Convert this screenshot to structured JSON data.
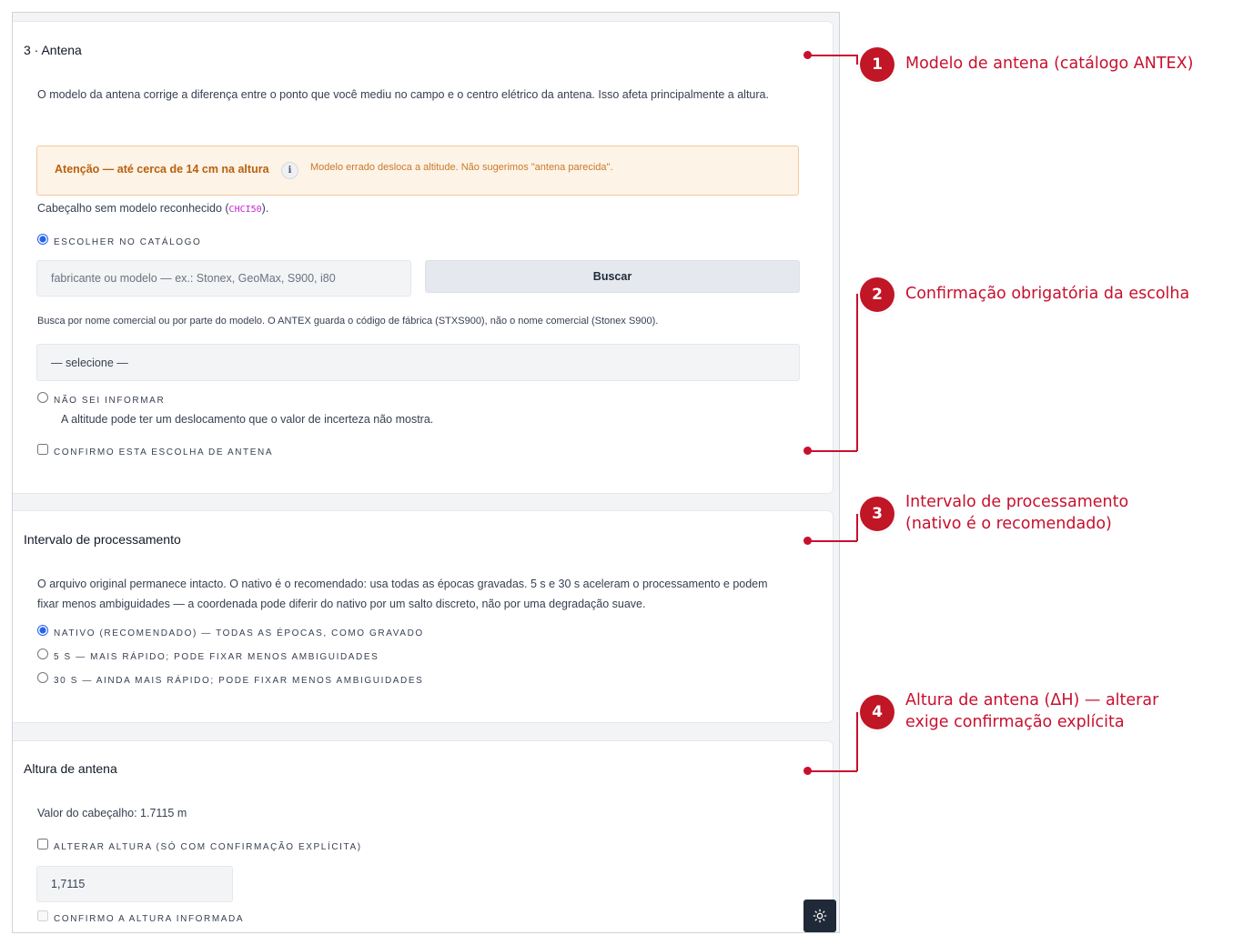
{
  "antenna_section": {
    "title": "3 · Antena",
    "description": "O modelo da antena corrige a diferença entre o ponto que você mediu no campo e o centro elétrico da antena. Isso afeta principalmente a altura.",
    "warning": {
      "title": "Atenção — até cerca de 14 cm na altura",
      "info_glyph": "i",
      "text": "Modelo errado desloca a altitude. Não sugerimos \"antena parecida\"."
    },
    "header_note_prefix": "Cabeçalho sem modelo reconhecido (",
    "header_code": "CHCI50",
    "header_note_suffix": ").",
    "option_catalog": "Escolher no catálogo",
    "search_placeholder": "fabricante ou modelo — ex.: Stonex, GeoMax, S900, i80",
    "search_button": "Buscar",
    "search_help": "Busca por nome comercial ou por parte do modelo. O ANTEX guarda o código de fábrica (STXS900), não o nome comercial (Stonex S900).",
    "select_value": "— selecione —",
    "option_unknown": "Não sei informar",
    "unknown_help": "A altitude pode ter um deslocamento que o valor de incerteza não mostra.",
    "confirm_label": "Confirmo esta escolha de antena"
  },
  "interval_section": {
    "title": "Intervalo de processamento",
    "description": "O arquivo original permanece intacto. O nativo é o recomendado: usa todas as épocas gravadas. 5 s e 30 s aceleram o processamento e podem fixar menos ambiguidades — a coordenada pode diferir do nativo por um salto discreto, não por uma degradação suave.",
    "options": [
      "Nativo (recomendado) — todas as épocas, como gravado",
      "5 s — mais rápido; pode fixar menos ambiguidades",
      "30 s — ainda mais rápido; pode fixar menos ambiguidades"
    ]
  },
  "height_section": {
    "title": "Altura de antena",
    "header_value": "Valor do cabeçalho: 1.7115 m",
    "alter_label": "Alterar altura (só com confirmação explícita)",
    "height_value": "1,7115",
    "confirm_label": "Confirmo a altura informada"
  },
  "annotations": [
    {
      "number": "1",
      "text": "Modelo de antena (catálogo ANTEX)"
    },
    {
      "number": "2",
      "text": "Confirmação obrigatória da escolha"
    },
    {
      "number": "3",
      "text": "Intervalo de processamento\n(nativo é o recomendado)"
    },
    {
      "number": "4",
      "text": "Altura de antena (ΔH) — alterar\nexige confirmação explícita"
    }
  ],
  "colors": {
    "annotation_red": "#c8102e",
    "warning_bg": "#fdf3e7",
    "warning_text": "#b8610e",
    "accent_blue": "#2563eb"
  },
  "icons": {
    "theme_toggle": "sun-icon",
    "warning_info": "info-icon"
  }
}
